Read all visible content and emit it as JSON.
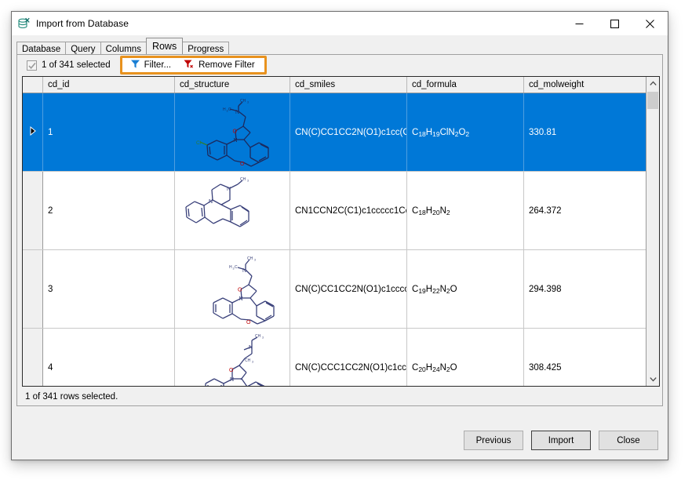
{
  "window": {
    "title": "Import from Database",
    "icon": "database-import-icon",
    "minimize_label": "Minimize",
    "maximize_label": "Maximize",
    "close_label": "Close"
  },
  "tabs": [
    {
      "label": "Database",
      "active": false
    },
    {
      "label": "Query",
      "active": false
    },
    {
      "label": "Columns",
      "active": false
    },
    {
      "label": "Rows",
      "active": true
    },
    {
      "label": "Progress",
      "active": false
    }
  ],
  "toolbar": {
    "select_all_checkbox_checked": true,
    "selection_label": "1 of 341 selected",
    "filter_label": "Filter...",
    "remove_filter_label": "Remove Filter",
    "highlight_color": "#e8921e",
    "filter_icon_color": "#1a7fd4",
    "remove_filter_icon_color": "#c00000"
  },
  "grid": {
    "columns": [
      "",
      "cd_id",
      "cd_structure",
      "cd_smiles",
      "cd_formula",
      "cd_molweight"
    ],
    "selection_color": "#0078d7",
    "rows": [
      {
        "selected": true,
        "indicator": "current-row-triangle",
        "cd_id": "1",
        "cd_structure": "chemical-structure-depiction",
        "cd_smiles": "CN(C)CC1CC2N(O1)c1cc(C…",
        "cd_formula": "C18H19ClN2O2",
        "cd_formula_parts": [
          {
            "t": "C"
          },
          {
            "s": "18"
          },
          {
            "t": "H"
          },
          {
            "s": "19"
          },
          {
            "t": "ClN"
          },
          {
            "s": "2"
          },
          {
            "t": "O"
          },
          {
            "s": "2"
          }
        ],
        "cd_molweight": "330.81"
      },
      {
        "selected": false,
        "indicator": "",
        "cd_id": "2",
        "cd_structure": "chemical-structure-depiction",
        "cd_smiles": "CN1CCN2C(C1)c1ccccc1Cc…",
        "cd_formula": "C18H20N2",
        "cd_formula_parts": [
          {
            "t": "C"
          },
          {
            "s": "18"
          },
          {
            "t": "H"
          },
          {
            "s": "20"
          },
          {
            "t": "N"
          },
          {
            "s": "2"
          }
        ],
        "cd_molweight": "264.372"
      },
      {
        "selected": false,
        "indicator": "",
        "cd_id": "3",
        "cd_structure": "chemical-structure-depiction",
        "cd_smiles": "CN(C)CC1CC2N(O1)c1cccc…",
        "cd_formula": "C19H22N2O",
        "cd_formula_parts": [
          {
            "t": "C"
          },
          {
            "s": "19"
          },
          {
            "t": "H"
          },
          {
            "s": "22"
          },
          {
            "t": "N"
          },
          {
            "s": "2"
          },
          {
            "t": "O"
          }
        ],
        "cd_molweight": "294.398"
      },
      {
        "selected": false,
        "indicator": "",
        "cd_id": "4",
        "cd_structure": "chemical-structure-depiction",
        "cd_smiles": "CN(C)CCC1CC2N(O1)c1cc…",
        "cd_formula": "C20H24N2O",
        "cd_formula_parts": [
          {
            "t": "C"
          },
          {
            "s": "20"
          },
          {
            "t": "H"
          },
          {
            "s": "24"
          },
          {
            "t": "N"
          },
          {
            "s": "2"
          },
          {
            "t": "O"
          }
        ],
        "cd_molweight": "308.425"
      }
    ]
  },
  "statusbar": {
    "text": "1 of 341 rows selected."
  },
  "buttons": {
    "previous": "Previous",
    "import": "Import",
    "close": "Close"
  }
}
